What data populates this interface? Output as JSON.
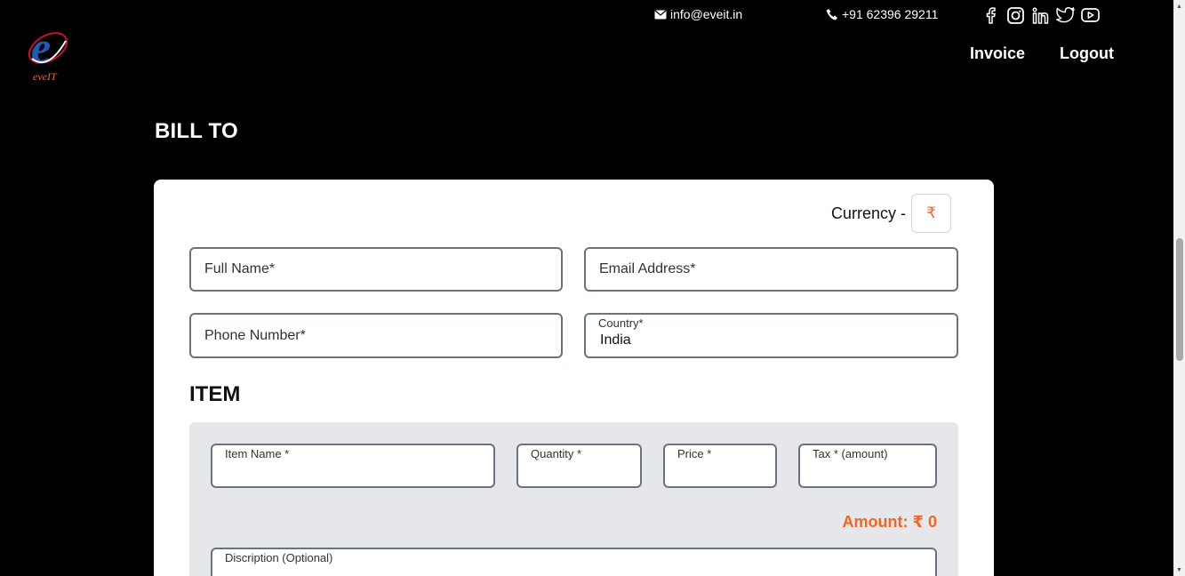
{
  "header": {
    "logo_text": "eveIT",
    "email": "info@eveit.in",
    "phone": "+91 62396 29211",
    "social_icons": [
      "facebook-icon",
      "instagram-icon",
      "linkedin-icon",
      "twitter-icon",
      "youtube-icon"
    ],
    "nav": {
      "invoice": "Invoice",
      "logout": "Logout"
    }
  },
  "bill_to": {
    "title": "BILL TO",
    "currency_label": "Currency -",
    "currency_symbol": "₹",
    "full_name_placeholder": "Full Name*",
    "email_placeholder": "Email Address*",
    "phone_placeholder": "Phone Number*",
    "country_label": "Country*",
    "country_value": "India"
  },
  "item": {
    "title": "ITEM",
    "item_name_label": "Item Name *",
    "quantity_label": "Quantity *",
    "price_label": "Price *",
    "tax_label": "Tax * (amount)",
    "amount_text": "Amount:  ₹ 0",
    "description_label": "Discription (Optional)"
  },
  "colors": {
    "accent": "#f26522",
    "background": "#000000",
    "card": "#ffffff",
    "item_box": "#e5e7eb",
    "logo_blue": "#1e5bb8"
  }
}
